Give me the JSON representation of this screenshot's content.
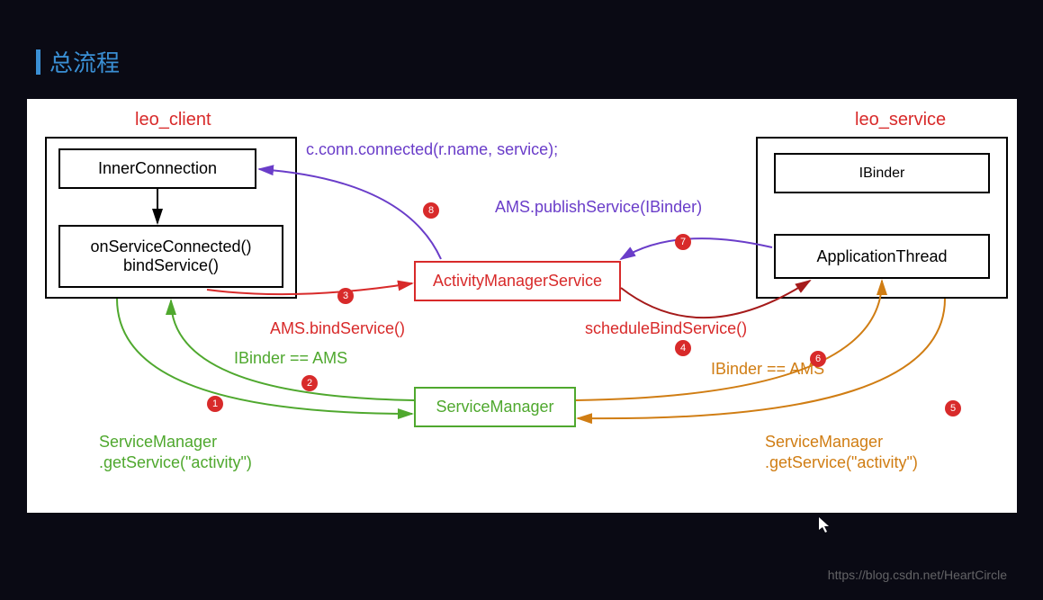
{
  "title": "总流程",
  "client": {
    "title": "leo_client",
    "inner_connection": "InnerConnection",
    "on_service_connected": "onServiceConnected()",
    "bind_service": "bindService()"
  },
  "service": {
    "title": "leo_service",
    "ibinder": "IBinder",
    "app_thread": "ApplicationThread"
  },
  "center": {
    "ams": "ActivityManagerService",
    "service_manager": "ServiceManager"
  },
  "labels": {
    "conn_connected": "c.conn.connected(r.name, service);",
    "publish_service": "AMS.publishService(IBinder)",
    "ams_bind_service": "AMS.bindService()",
    "schedule_bind": "scheduleBindService()",
    "ibinder_ams_left": "IBinder == AMS",
    "ibinder_ams_right": "IBinder == AMS",
    "sm_get_left": "ServiceManager\n.getService(\"activity\")",
    "sm_get_right": "ServiceManager\n.getService(\"activity\")"
  },
  "badges": {
    "b1": "1",
    "b2": "2",
    "b3": "3",
    "b4": "4",
    "b5": "5",
    "b6": "6",
    "b7": "7",
    "b8": "8"
  },
  "watermark": "https://blog.csdn.net/HeartCircle"
}
